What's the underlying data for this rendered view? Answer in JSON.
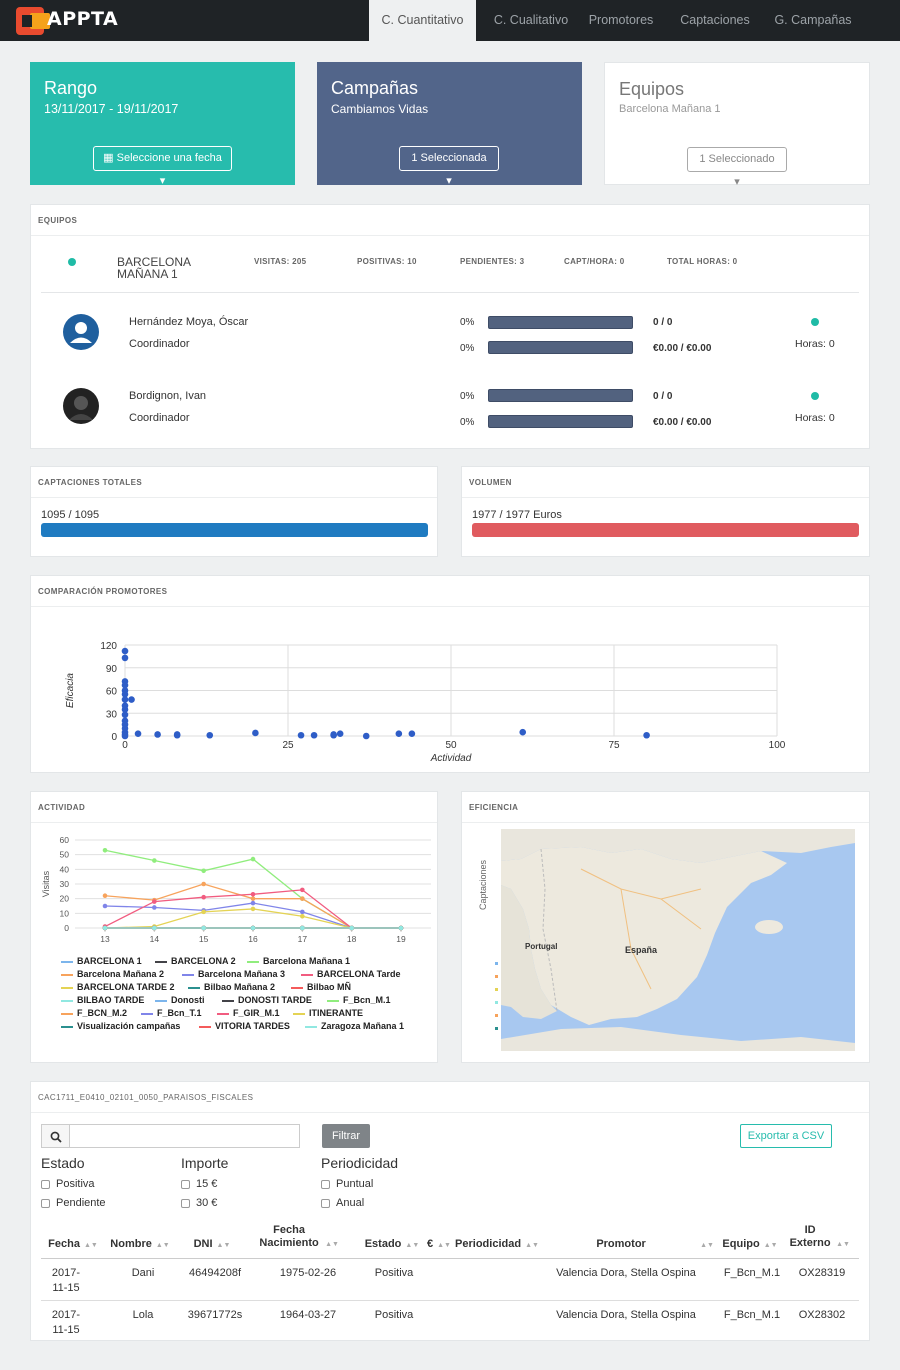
{
  "app": {
    "logo_text": "APPTA"
  },
  "nav": {
    "tabs": [
      "C. Cuantitativo",
      "C. Cualitativo",
      "Promotores",
      "Captaciones",
      "G. Campañas"
    ],
    "active": 0
  },
  "kpis": {
    "rango": {
      "title": "Rango",
      "sub": "13/11/2017 - 19/11/2017",
      "button": "Seleccione una fecha",
      "color": "#27bcad"
    },
    "campanas": {
      "title": "Campañas",
      "sub": "Cambiamos Vidas",
      "button": "1 Seleccionada",
      "color": "#52658a"
    },
    "equipos": {
      "title": "Equipos",
      "sub": "Barcelona Mañana 1",
      "button": "1 Seleccionado"
    }
  },
  "equipos_section": {
    "title": "EQUIPOS",
    "team": {
      "name": "BARCELONA MAÑANA 1",
      "stats": [
        "VISITAS: 205",
        "POSITIVAS: 10",
        "PENDIENTES: 3",
        "CAPT/HORA: 0",
        "TOTAL HORAS: 0"
      ]
    },
    "members": [
      {
        "name": "Hernández Moya, Óscar",
        "role": "Coordinador",
        "pct1": "0%",
        "pct2": "0%",
        "val1": "0 / 0",
        "val2": "€0.00 / €0.00",
        "horas": "Horas: 0"
      },
      {
        "name": "Bordignon, Ivan",
        "role": "Coordinador",
        "pct1": "0%",
        "pct2": "0%",
        "val1": "0 / 0",
        "val2": "€0.00 / €0.00",
        "horas": "Horas: 0"
      }
    ]
  },
  "captaciones": {
    "title": "CAPTACIONES TOTALES",
    "value": "1095 / 1095",
    "progress": 1.0,
    "color": "#1f7bc1"
  },
  "volumen": {
    "title": "VOLUMEN",
    "value": "1977 / 1977 Euros",
    "progress": 1.0,
    "color": "#e05b5f"
  },
  "comparacion": {
    "title": "COMPARACIÓN PROMOTORES"
  },
  "actividad": {
    "title": "ACTIVIDAD"
  },
  "eficiencia": {
    "title": "EFICIENCIA",
    "ylabel": "Captaciones",
    "map_labels": {
      "portugal": "Portugal",
      "espana": "España"
    }
  },
  "chart_data": [
    {
      "type": "scatter",
      "title": "",
      "xlabel": "Actividad",
      "ylabel": "Eficacia",
      "xlim": [
        0,
        100
      ],
      "ylim": [
        0,
        120
      ],
      "xticks": [
        0,
        25,
        50,
        75,
        100
      ],
      "yticks": [
        0,
        30,
        60,
        90,
        120
      ],
      "grid": true,
      "points": [
        [
          0,
          112
        ],
        [
          0,
          103
        ],
        [
          0,
          72
        ],
        [
          0,
          67
        ],
        [
          0,
          60
        ],
        [
          0,
          55
        ],
        [
          0,
          48
        ],
        [
          0,
          40
        ],
        [
          0,
          35
        ],
        [
          0,
          28
        ],
        [
          0,
          20
        ],
        [
          0,
          15
        ],
        [
          0,
          10
        ],
        [
          0,
          5
        ],
        [
          0,
          2
        ],
        [
          0,
          0
        ],
        [
          1,
          48
        ],
        [
          2,
          3
        ],
        [
          5,
          2
        ],
        [
          8,
          1
        ],
        [
          8,
          2
        ],
        [
          13,
          1
        ],
        [
          20,
          4
        ],
        [
          27,
          1
        ],
        [
          29,
          1
        ],
        [
          32,
          1
        ],
        [
          32,
          2
        ],
        [
          33,
          3
        ],
        [
          37,
          0
        ],
        [
          42,
          3
        ],
        [
          44,
          3
        ],
        [
          61,
          5
        ],
        [
          80,
          1
        ]
      ]
    },
    {
      "type": "line",
      "title": "",
      "xlabel": "",
      "ylabel": "Visitas",
      "ylim": [
        0,
        60
      ],
      "yticks": [
        0,
        10,
        20,
        30,
        40,
        50,
        60
      ],
      "x": [
        13,
        14,
        15,
        16,
        17,
        18,
        19
      ],
      "grid": true,
      "legend": "bottom",
      "series": [
        {
          "name": "BARCELONA 1",
          "color": "#7cb5ec",
          "values": [
            0,
            0,
            0,
            0,
            0,
            0,
            0
          ]
        },
        {
          "name": "BARCELONA 2",
          "color": "#434348",
          "values": [
            0,
            0,
            0,
            0,
            0,
            0,
            0
          ]
        },
        {
          "name": "Barcelona Mañana 1",
          "color": "#90ed7d",
          "values": [
            53,
            46,
            39,
            47,
            20,
            0,
            0
          ]
        },
        {
          "name": "Barcelona Mañana 2",
          "color": "#f7a35c",
          "values": [
            22,
            19,
            30,
            20,
            20,
            0,
            0
          ]
        },
        {
          "name": "Barcelona Mañana 3",
          "color": "#8085e9",
          "values": [
            15,
            14,
            12,
            17,
            11,
            0,
            0
          ]
        },
        {
          "name": "BARCELONA Tarde",
          "color": "#f15c80",
          "values": [
            1,
            18,
            21,
            23,
            26,
            0,
            0
          ]
        },
        {
          "name": "BARCELONA TARDE 2",
          "color": "#e4d354",
          "values": [
            0,
            1,
            11,
            13,
            8,
            0,
            0
          ]
        },
        {
          "name": "Bilbao Mañana 2",
          "color": "#2b908f",
          "values": [
            0,
            0,
            0,
            0,
            0,
            0,
            0
          ]
        },
        {
          "name": "Bilbao MÑ",
          "color": "#f45b5b",
          "values": [
            0,
            0,
            0,
            0,
            0,
            0,
            0
          ]
        },
        {
          "name": "BILBAO TARDE",
          "color": "#91e8e1",
          "values": [
            0,
            0,
            0,
            0,
            0,
            0,
            0
          ]
        },
        {
          "name": "Donosti",
          "color": "#7cb5ec",
          "values": [
            0,
            0,
            0,
            0,
            0,
            0,
            0
          ]
        },
        {
          "name": "DONOSTI TARDE",
          "color": "#434348",
          "values": [
            0,
            0,
            0,
            0,
            0,
            0,
            0
          ]
        },
        {
          "name": "F_Bcn_M.1",
          "color": "#90ed7d",
          "values": [
            0,
            0,
            0,
            0,
            0,
            0,
            0
          ]
        },
        {
          "name": "F_BCN_M.2",
          "color": "#f7a35c",
          "values": [
            0,
            0,
            0,
            0,
            0,
            0,
            0
          ]
        },
        {
          "name": "F_Bcn_T.1",
          "color": "#8085e9",
          "values": [
            0,
            0,
            0,
            0,
            0,
            0,
            0
          ]
        },
        {
          "name": "F_GIR_M.1",
          "color": "#f15c80",
          "values": [
            0,
            0,
            0,
            0,
            0,
            0,
            0
          ]
        },
        {
          "name": "ITINERANTE",
          "color": "#e4d354",
          "values": [
            0,
            0,
            0,
            0,
            0,
            0,
            0
          ]
        },
        {
          "name": "Visualización campañas",
          "color": "#2b908f",
          "values": [
            0,
            0,
            0,
            0,
            0,
            0,
            0
          ]
        },
        {
          "name": "VITORIA TARDES",
          "color": "#f45b5b",
          "values": [
            0,
            0,
            0,
            0,
            0,
            0,
            0
          ]
        },
        {
          "name": "Zaragoza Mañana 1",
          "color": "#91e8e1",
          "values": [
            0,
            0,
            0,
            0,
            0,
            0,
            0
          ]
        }
      ]
    }
  ],
  "table_section": {
    "title": "CAC1711_E0410_02101_0050_PARAISOS_FISCALES",
    "search_placeholder": "",
    "filter_btn": "Filtrar",
    "export_btn": "Exportar a CSV",
    "groups": [
      {
        "title": "Estado",
        "options": [
          "Positiva",
          "Pendiente"
        ]
      },
      {
        "title": "Importe",
        "options": [
          "15 €",
          "30 €"
        ]
      },
      {
        "title": "Periodicidad",
        "options": [
          "Puntual",
          "Anual"
        ]
      }
    ],
    "columns": [
      "Fecha",
      "Nombre",
      "DNI",
      "Fecha Nacimiento",
      "Estado",
      "€",
      "Periodicidad",
      "Promotor",
      "Equipo",
      "ID Externo"
    ],
    "rows": [
      [
        "2017-11-15",
        "Dani",
        "46494208f",
        "1975-02-26",
        "Positiva",
        "",
        "",
        "Valencia Dora, Stella Ospina",
        "F_Bcn_M.1",
        "OX28319"
      ],
      [
        "2017-11-15",
        "Lola",
        "39671772s",
        "1964-03-27",
        "Positiva",
        "",
        "",
        "Valencia Dora, Stella Ospina",
        "F_Bcn_M.1",
        "OX28302"
      ]
    ]
  }
}
